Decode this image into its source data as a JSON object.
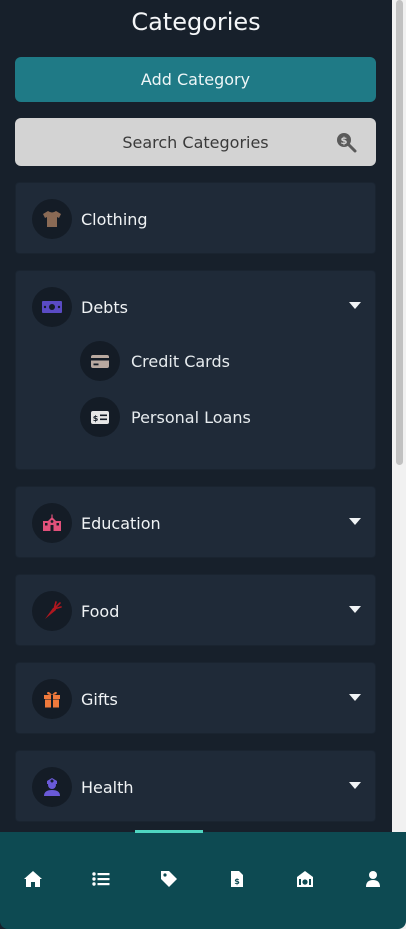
{
  "header": {
    "title": "Categories"
  },
  "actions": {
    "add_label": "Add Category"
  },
  "search": {
    "placeholder": "Search Categories",
    "icon": "search-dollar-icon"
  },
  "categories": [
    {
      "name": "Clothing",
      "icon": "shirt-icon",
      "icon_color": "#8a6a55",
      "expanded": false,
      "has_chevron": false
    },
    {
      "name": "Debts",
      "icon": "money-bill-icon",
      "icon_color": "#5a4bc4",
      "expanded": true,
      "has_chevron": true,
      "children": [
        {
          "name": "Credit Cards",
          "icon": "credit-card-icon",
          "icon_color": "#b9a9a0"
        },
        {
          "name": "Personal Loans",
          "icon": "money-check-icon",
          "icon_color": "#e6e6e6"
        }
      ]
    },
    {
      "name": "Education",
      "icon": "school-icon",
      "icon_color": "#e0507a",
      "expanded": false,
      "has_chevron": true
    },
    {
      "name": "Food",
      "icon": "carrot-icon",
      "icon_color": "#b0171f",
      "expanded": false,
      "has_chevron": true
    },
    {
      "name": "Gifts",
      "icon": "gift-icon",
      "icon_color": "#f07a3c",
      "expanded": false,
      "has_chevron": true
    },
    {
      "name": "Health",
      "icon": "user-nurse-icon",
      "icon_color": "#6a5ad8",
      "expanded": false,
      "has_chevron": true
    }
  ],
  "nav": {
    "active_index": 2,
    "items": [
      "home-icon",
      "list-icon",
      "tag-icon",
      "receipt-icon",
      "piggy-bank-icon",
      "user-icon"
    ]
  },
  "colors": {
    "accent": "#1f7a86",
    "nav_bg": "#0d4a52",
    "indicator": "#4fd6c1",
    "card_bg": "#1f2a38"
  }
}
